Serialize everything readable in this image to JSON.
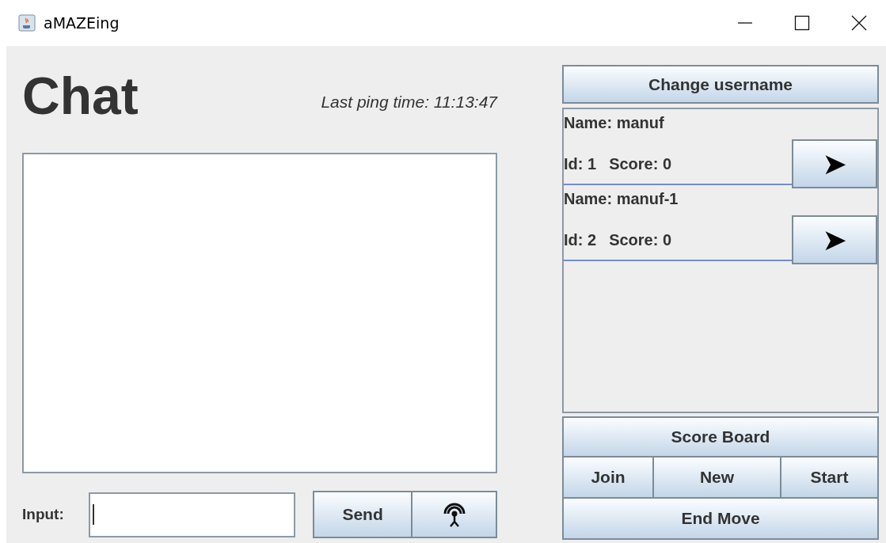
{
  "window": {
    "title": "aMAZEing"
  },
  "chat": {
    "title": "Chat",
    "last_ping": "Last ping time: 11:13:47",
    "input_label": "Input:",
    "send_button": "Send"
  },
  "change_username_button": "Change username",
  "players": [
    {
      "name": "Name: manuf",
      "id": "Id: 1",
      "score": "Score: 0",
      "arrow": "➤"
    },
    {
      "name": "Name: manuf-1",
      "id": "Id: 2",
      "score": "Score: 0",
      "arrow": "➤"
    }
  ],
  "score_board_button": "Score Board",
  "game_buttons": [
    "Join",
    "New",
    "Start"
  ],
  "end_move_button": "End Move"
}
